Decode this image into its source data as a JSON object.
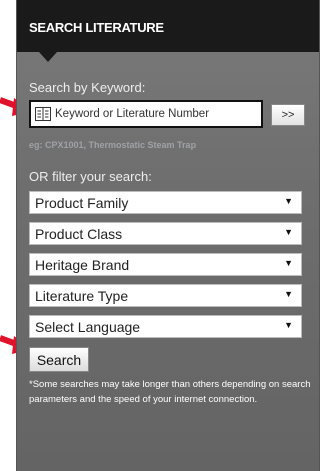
{
  "panel": {
    "title": "SEARCH LITERATURE",
    "keyword_label": "Search by Keyword:",
    "keyword_placeholder": "Keyword or Literature Number",
    "go_label": ">>",
    "example": "eg: CPX1001, Thermostatic Steam Trap",
    "filter_label": "OR filter your search:",
    "filters": [
      "Product Family",
      "Product Class",
      "Heritage Brand",
      "Literature Type",
      "Select Language"
    ],
    "search_label": "Search",
    "note": "*Some searches may take longer than others depending on search parameters and the speed of your internet connection."
  },
  "colors": {
    "header": "#1a1a1a",
    "panel": "#707070",
    "arrow": "#e0122b"
  },
  "icons": [
    "document-icon",
    "dropdown-arrow-icon",
    "pointer-arrow-icon"
  ]
}
